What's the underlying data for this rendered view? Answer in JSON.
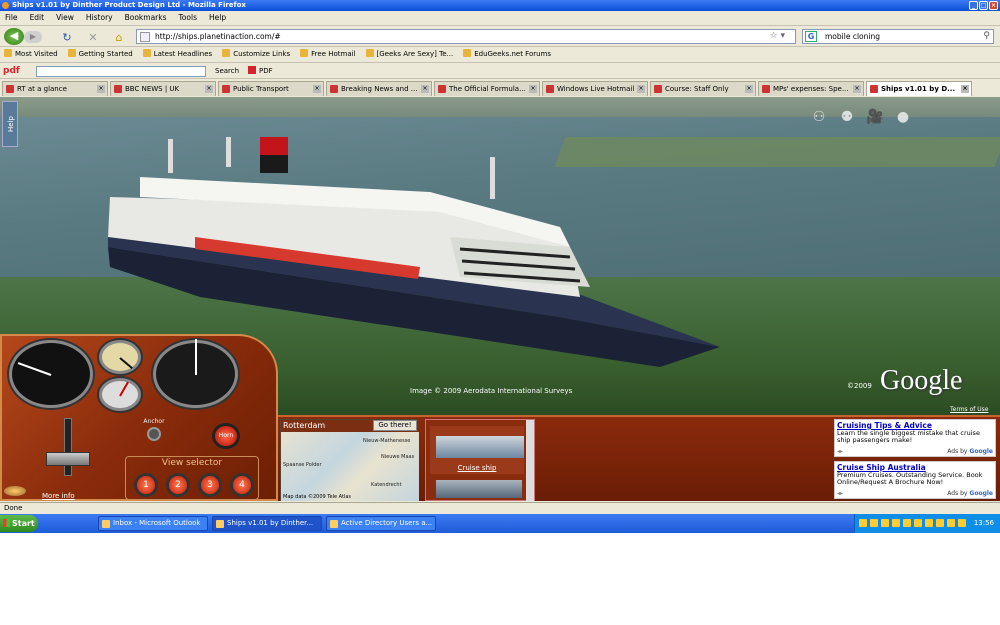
{
  "window": {
    "title": "Ships v1.01 by Dinther Product Design Ltd - Mozilla Firefox"
  },
  "menu": [
    "File",
    "Edit",
    "View",
    "History",
    "Bookmarks",
    "Tools",
    "Help"
  ],
  "nav": {
    "url": "http://ships.planetinaction.com/#",
    "search_value": "mobile cloning"
  },
  "bookmarks": [
    "Most Visited",
    "Getting Started",
    "Latest Headlines",
    "Customize Links",
    "Free Hotmail",
    "[Geeks Are Sexy] Te...",
    "EduGeeks.net Forums"
  ],
  "pdfbar": {
    "logo": "pdf",
    "search_label": "Search",
    "pdf_label": "PDF"
  },
  "tabs": [
    {
      "label": "RT at a glance",
      "active": false
    },
    {
      "label": "BBC NEWS | UK",
      "active": false
    },
    {
      "label": "Public Transport",
      "active": false
    },
    {
      "label": "Breaking News and ...",
      "active": false
    },
    {
      "label": "The Official Formula...",
      "active": false
    },
    {
      "label": "Windows Live Hotmail",
      "active": false
    },
    {
      "label": "Course: Staff Only",
      "active": false
    },
    {
      "label": "MPs' expenses: Spe...",
      "active": false
    },
    {
      "label": "Ships v1.01 by D...",
      "active": true
    }
  ],
  "map": {
    "help_tab": "Help",
    "imagery_credit": "Image © 2009 Aerodata International Surveys",
    "copyright_year": "©2009",
    "google_logo": "Google",
    "terms": "Terms of Use"
  },
  "dashboard": {
    "more_info": "More info",
    "toggle_label": "Anchor",
    "horn_label": "Horn",
    "view_selector_label": "View selector",
    "view_buttons": [
      "1",
      "2",
      "3",
      "4"
    ]
  },
  "city": {
    "name": "Rotterdam",
    "go_button": "Go there!",
    "map_labels": [
      "Nieuw-Mathenesse",
      "Nieuwe Maas",
      "Spaanse Polder",
      "Katendrecht"
    ],
    "map_copyright": "Map data ©2009 Tele Atlas"
  },
  "ships": {
    "items": [
      {
        "caption": "Cruise ship"
      }
    ]
  },
  "ads": [
    {
      "title": "Cruising Tips & Advice",
      "body": "Learn the single biggest mistake that cruise ship passengers make!",
      "by": "Ads by",
      "brand": "Google"
    },
    {
      "title": "Cruise Ship Australia",
      "body": "Premium Cruises. Outstanding Service. Book Online/Request A Brochure Now!",
      "by": "Ads by",
      "brand": "Google"
    }
  ],
  "status": {
    "text": "Done"
  },
  "taskbar": {
    "start": "Start",
    "tasks": [
      "Inbox - Microsoft Outlook",
      "Ships v1.01 by Dinther...",
      "Active Directory Users a..."
    ],
    "clock": "13:56"
  }
}
